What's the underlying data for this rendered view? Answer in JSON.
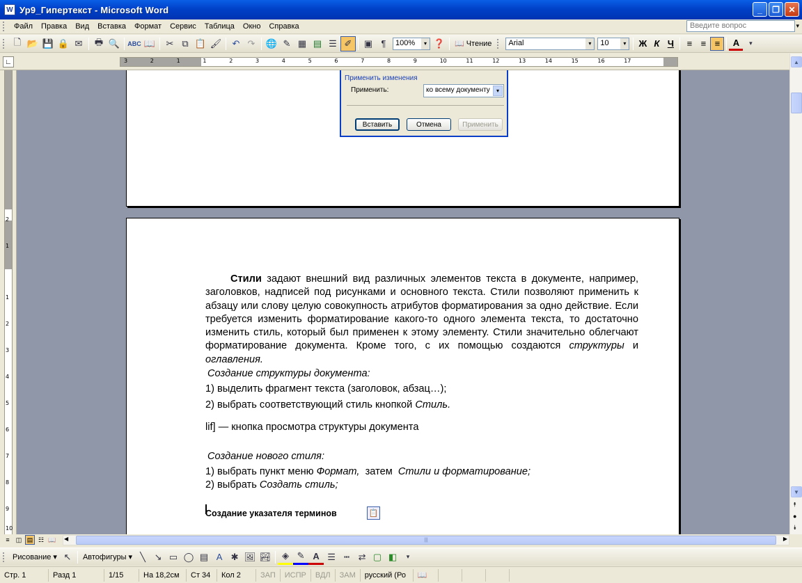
{
  "window": {
    "title": "Ур9_Гипертекст - Microsoft Word",
    "app_icon": "W"
  },
  "menu": [
    "Файл",
    "Правка",
    "Вид",
    "Вставка",
    "Формат",
    "Сервис",
    "Таблица",
    "Окно",
    "Справка"
  ],
  "ask_question": {
    "placeholder": "Введите вопрос"
  },
  "toolbar": {
    "zoom": "100%",
    "reading": "Чтение",
    "font": "Arial",
    "size": "10"
  },
  "ruler": {
    "h_labels": [
      "3",
      "2",
      "1",
      "1",
      "2",
      "3",
      "4",
      "5",
      "6",
      "7",
      "8",
      "9",
      "10",
      "11",
      "12",
      "13",
      "14",
      "15",
      "16",
      "17"
    ],
    "v_labels": [
      "2",
      "1",
      "1",
      "2",
      "3",
      "4",
      "5",
      "6",
      "7",
      "8",
      "9",
      "10"
    ]
  },
  "dialog": {
    "section": "Применить изменения",
    "apply_label": "Применить:",
    "apply_value": "ко всему документу",
    "insert": "Вставить",
    "cancel": "Отмена",
    "apply_btn": "Применить"
  },
  "document": {
    "p1_bold": "Стили",
    "p1_text": " задают внешний вид различных элементов текста в документе, например, заголовков, надписей под рисунками и основного текста. Стили позволяют применить к абзацу или слову целую совокупность атрибутов форматирования за одно действие. Если требуется изменить форматирование какого-то одного элемента текста, то достаточно изменить стиль, который был применен к этому элементу. Стили значительно облегчают форматирование документа. Кроме того, с их помощью создаются ",
    "p1_it1": "структуры",
    "p1_and": " и ",
    "p1_it2": "оглавления.",
    "h_structure": "Создание структуры документа:",
    "s1": "1)  выделить фрагмент текста (заголовок, абзац…);",
    "s2_pre": "2)  выбрать соответствующий стиль кнопкой ",
    "s2_it": "Стиль.",
    "lif": "lif] — кнопка просмотра структуры документа",
    "h_newstyle": "Создание нового стиля:",
    "n1_pre": "1) выбрать пункт меню ",
    "n1_it1": "Формат,",
    "n1_mid": "  затем  ",
    "n1_it2": "Стили и форматирование;",
    "n2_pre": "2) выбрать ",
    "n2_it": "Создать стиль;",
    "h_index": "Создание указателя терминов"
  },
  "drawing": {
    "draw": "Рисование",
    "autoshapes": "Автофигуры"
  },
  "status": {
    "page": "Стр.  1",
    "section": "Разд  1",
    "pages": "1/15",
    "at": "На 18,2см",
    "line": "Ст 34",
    "col": "Кол  2",
    "rec": "ЗАП",
    "trk": "ИСПР",
    "ext": "ВДЛ",
    "ovr": "ЗАМ",
    "lang": "русский (Ро"
  }
}
